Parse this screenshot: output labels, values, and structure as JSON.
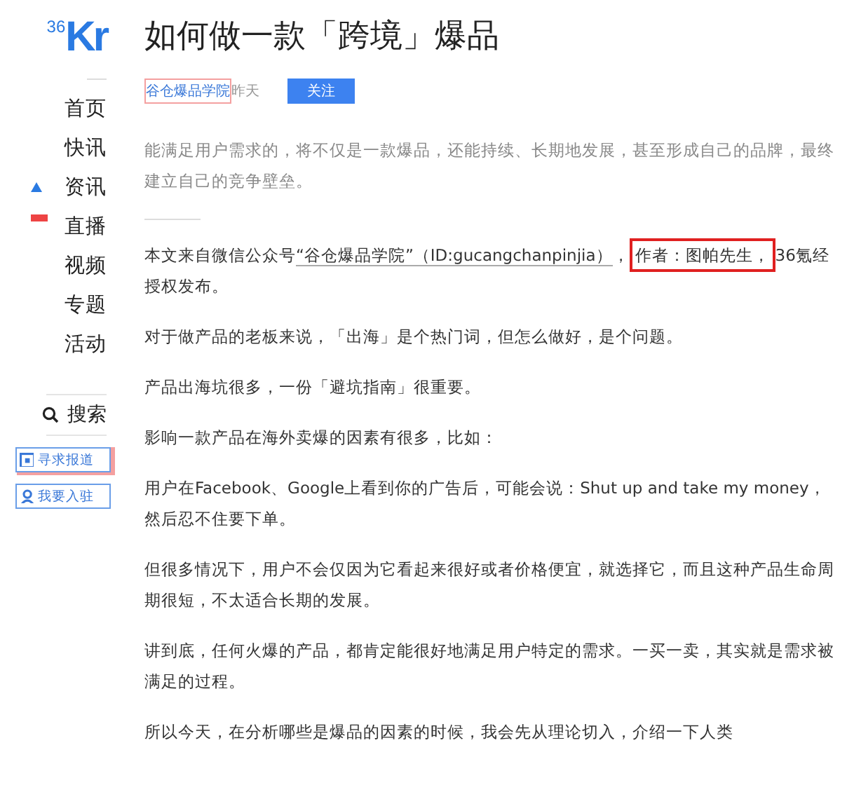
{
  "sidebar": {
    "logo": {
      "digits": "36",
      "letters": "Kr"
    },
    "nav_items": [
      {
        "label": "首页",
        "arrow": false,
        "new_badge": false
      },
      {
        "label": "快讯",
        "arrow": false,
        "new_badge": false
      },
      {
        "label": "资讯",
        "arrow": true,
        "new_badge": false
      },
      {
        "label": "直播",
        "arrow": false,
        "new_badge": true
      },
      {
        "label": "视频",
        "arrow": false,
        "new_badge": false
      },
      {
        "label": "专题",
        "arrow": false,
        "new_badge": false
      },
      {
        "label": "活动",
        "arrow": false,
        "new_badge": false
      }
    ],
    "search": {
      "label": "搜索"
    },
    "buttons": [
      {
        "label": "寻求报道",
        "highlighted": true
      },
      {
        "label": "我要入驻",
        "highlighted": false
      }
    ]
  },
  "article": {
    "title": "如何做一款「跨境」爆品",
    "author": {
      "name": "谷仓爆品学院",
      "highlighted": true
    },
    "time": "昨天",
    "follow_button": "关注",
    "summary": "能满足用户需求的，将不仅是一款爆品，还能持续、长期地发展，甚至形成自己的品牌，最终建立自己的竞争壁垒。",
    "paragraphs": [
      {
        "segments": [
          {
            "kind": "text",
            "text": "本文来自微信公众号"
          },
          {
            "kind": "link",
            "text": "“谷仓爆品学院”（ID:gucangchanpinjia）"
          },
          {
            "kind": "text",
            "text": "，"
          },
          {
            "kind": "highlight",
            "text": "作者：图帕先生，"
          },
          {
            "kind": "text",
            "text": "36氪经授权发布。"
          }
        ]
      },
      {
        "segments": [
          {
            "kind": "text",
            "text": "对于做产品的老板来说，「出海」是个热门词，但怎么做好，是个问题。"
          }
        ]
      },
      {
        "segments": [
          {
            "kind": "text",
            "text": "产品出海坑很多，一份「避坑指南」很重要。"
          }
        ]
      },
      {
        "segments": [
          {
            "kind": "text",
            "text": "影响一款产品在海外卖爆的因素有很多，比如："
          }
        ]
      },
      {
        "segments": [
          {
            "kind": "text",
            "text": "用户在Facebook、Google上看到你的广告后，可能会说：Shut up and take my money，然后忍不住要下单。"
          }
        ]
      },
      {
        "segments": [
          {
            "kind": "text",
            "text": "但很多情况下，用户不会仅因为它看起来很好或者价格便宜，就选择它，而且这种产品生命周期很短，不太适合长期的发展。"
          }
        ]
      },
      {
        "segments": [
          {
            "kind": "text",
            "text": "讲到底，任何火爆的产品，都肯定能很好地满足用户特定的需求。一买一卖，其实就是需求被满足的过程。"
          }
        ]
      },
      {
        "segments": [
          {
            "kind": "text",
            "text": "所以今天，在分析哪些是爆品的因素的时候，我会先从理论切入，介绍一下人类"
          }
        ]
      }
    ]
  }
}
